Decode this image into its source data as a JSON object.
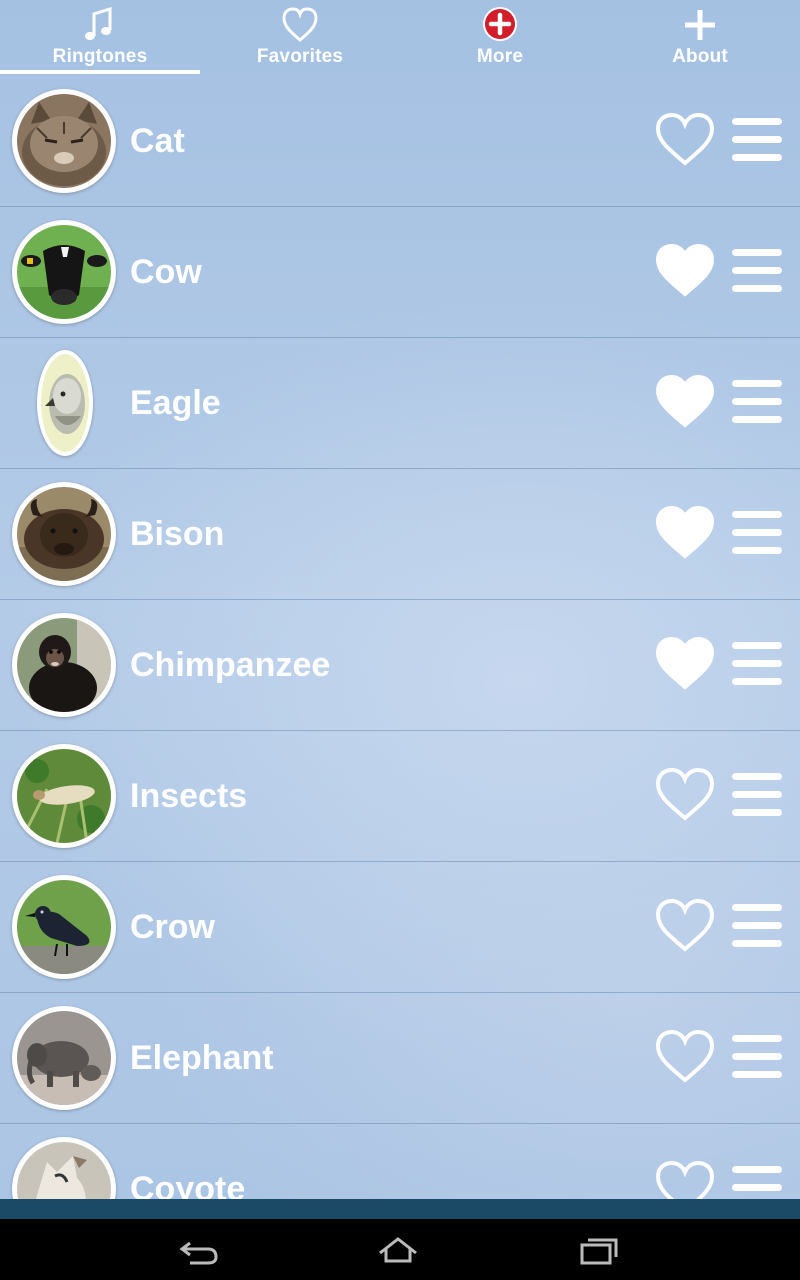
{
  "tabs": [
    {
      "label": "Ringtones",
      "icon": "music-note-icon",
      "selected": true
    },
    {
      "label": "Favorites",
      "icon": "heart-outline-icon",
      "selected": false
    },
    {
      "label": "More",
      "icon": "red-plus-badge-icon",
      "selected": false
    },
    {
      "label": "About",
      "icon": "plus-icon",
      "selected": false
    }
  ],
  "list": {
    "items": [
      {
        "name": "Cat",
        "favorite": false,
        "thumbnail": "cat-photo"
      },
      {
        "name": "Cow",
        "favorite": true,
        "thumbnail": "cow-photo"
      },
      {
        "name": "Eagle",
        "favorite": true,
        "thumbnail": "eagle-photo"
      },
      {
        "name": "Bison",
        "favorite": true,
        "thumbnail": "bison-photo"
      },
      {
        "name": "Chimpanzee",
        "favorite": true,
        "thumbnail": "chimpanzee-photo"
      },
      {
        "name": "Insects",
        "favorite": false,
        "thumbnail": "insects-photo"
      },
      {
        "name": "Crow",
        "favorite": false,
        "thumbnail": "crow-photo"
      },
      {
        "name": "Elephant",
        "favorite": false,
        "thumbnail": "elephant-photo"
      },
      {
        "name": "Coyote",
        "favorite": false,
        "thumbnail": "coyote-photo"
      }
    ]
  },
  "navbar": {
    "buttons": [
      "back-icon",
      "home-icon",
      "recent-apps-icon"
    ]
  },
  "colors": {
    "background": "#abc5e4",
    "text": "#ffffff",
    "separator": "#6e8caf",
    "bottom_strip": "#1b4a66",
    "navbar": "#000000"
  }
}
